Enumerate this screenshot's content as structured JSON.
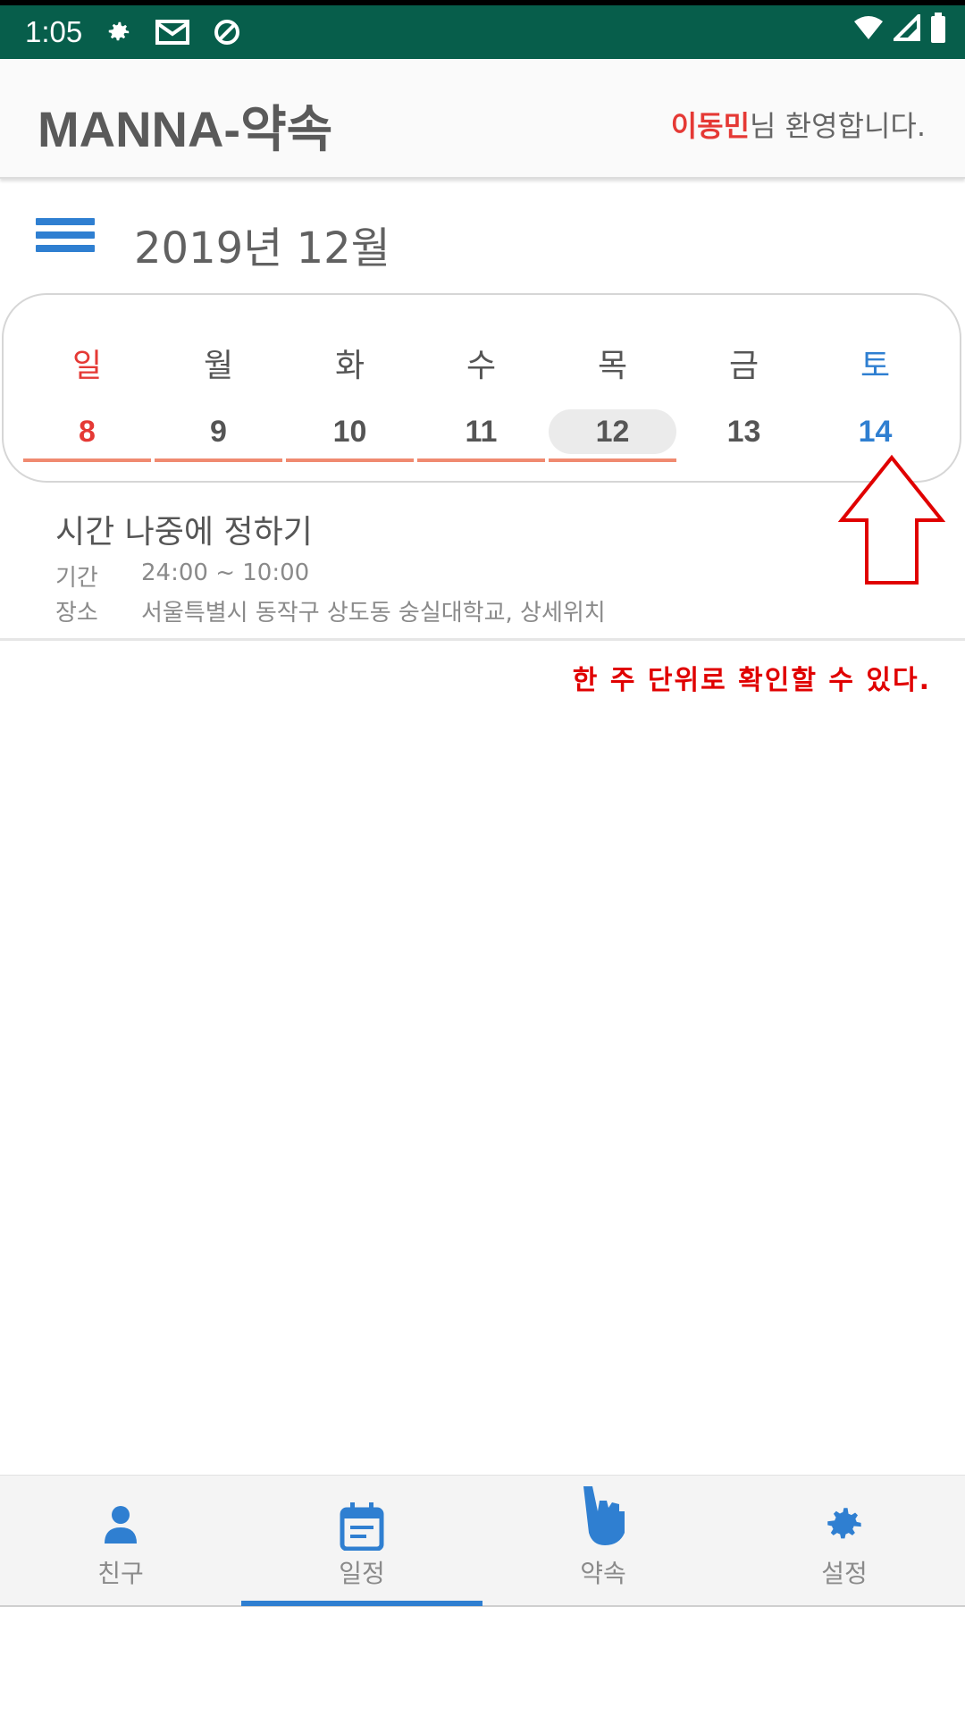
{
  "status_bar": {
    "time": "1:05",
    "icons": [
      "gear-icon",
      "gmail-icon",
      "blocked-icon",
      "wifi-icon",
      "signal-icon",
      "battery-icon"
    ]
  },
  "app_bar": {
    "title": "MANNA-약속",
    "user_name": "이동민",
    "welcome_suffix": "님 환영합니다."
  },
  "calendar": {
    "month_label": "2019년 12월",
    "days": [
      {
        "name": "일",
        "date": "8"
      },
      {
        "name": "월",
        "date": "9"
      },
      {
        "name": "화",
        "date": "10"
      },
      {
        "name": "수",
        "date": "11"
      },
      {
        "name": "목",
        "date": "12"
      },
      {
        "name": "금",
        "date": "13"
      },
      {
        "name": "토",
        "date": "14"
      }
    ],
    "selected_date": "12",
    "underlined_dates": [
      "8",
      "9",
      "10",
      "11",
      "12"
    ]
  },
  "event": {
    "title": "시간 나중에 정하기",
    "period_label": "기간",
    "period_value": "24:00 ~ 10:00",
    "place_label": "장소",
    "place_value": "서울특별시 동작구 상도동 숭실대학교, 상세위치"
  },
  "annotation": "한 주 단위로 확인할 수 있다.",
  "bottom_nav": {
    "items": [
      {
        "label": "친구",
        "icon": "person-icon"
      },
      {
        "label": "일정",
        "icon": "calendar-icon"
      },
      {
        "label": "약속",
        "icon": "hand-icon"
      },
      {
        "label": "설정",
        "icon": "gear-icon"
      }
    ],
    "active": "일정"
  },
  "colors": {
    "status_bar": "#075e4b",
    "accent": "#2f7fd1",
    "sunday": "#e53935",
    "underline": "#f08a70",
    "annotation": "#e00000"
  }
}
